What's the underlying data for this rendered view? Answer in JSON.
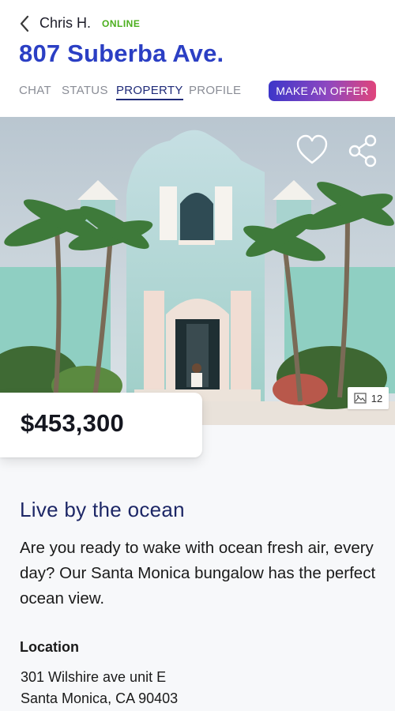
{
  "header": {
    "back_icon": "chevron-left-icon",
    "contact_name": "Chris H.",
    "status": "ONLINE",
    "status_color": "#4caf1e",
    "title": "807 Suberba Ave.",
    "title_color": "#2b3fc4"
  },
  "tabs": [
    {
      "label": "CHAT",
      "active": false
    },
    {
      "label": "STATUS",
      "active": false
    },
    {
      "label": "PROPERTY",
      "active": true
    },
    {
      "label": "PROFILE",
      "active": false
    }
  ],
  "offer_button": {
    "label": "MAKE AN OFFER",
    "gradient": [
      "#3d36c9",
      "#8e47c0",
      "#e0457b"
    ]
  },
  "hero": {
    "image": "mint-green-stucco-house-with-palm-trees",
    "favorite_icon": "heart-outline-icon",
    "share_icon": "share-icon",
    "photo_count_icon": "image-icon",
    "photo_count": "12"
  },
  "listing": {
    "price": "$453,300",
    "headline": "Live by the ocean",
    "description": "Are you ready to wake with ocean fresh air, every day? Our Santa Monica bungalow has the perfect ocean view.",
    "location_label": "Location",
    "address_line1": "301 Wilshire ave unit E",
    "address_line2": "Santa Monica, CA 90403"
  }
}
